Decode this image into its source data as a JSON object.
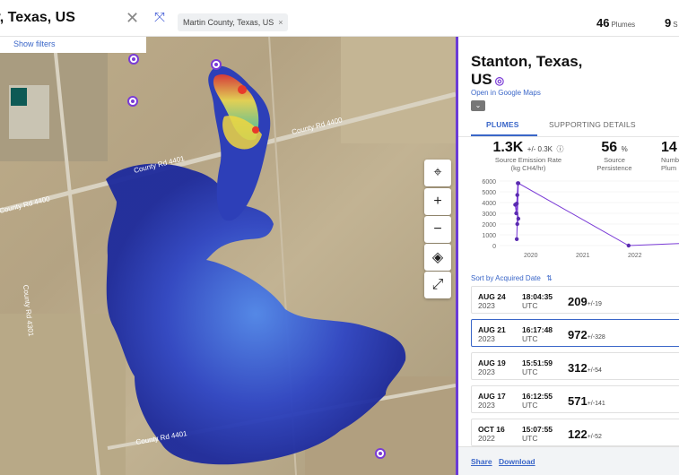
{
  "search": {
    "value": "y, Texas, US",
    "show_filters": "Show filters"
  },
  "filter_chip": {
    "label": "Martin County, Texas, US",
    "close": "×"
  },
  "counts": {
    "plumes_value": "46",
    "plumes_label": "Plumes",
    "sources_value": "9",
    "sources_label": "S"
  },
  "map": {
    "road_labels": [
      "County Rd 4400",
      "County Rd 4401",
      "County Rd 4400",
      "County Rd 4301",
      "County Rd 4401"
    ],
    "controls": [
      "locate-icon",
      "zoom-in-icon",
      "zoom-out-icon",
      "layers-icon",
      "measure-icon"
    ],
    "plume_colors": {
      "low": "#1f2fa6",
      "mid": "#3b6fe0",
      "high": "#f5e04a",
      "peak": "#e83a2a"
    }
  },
  "panel": {
    "title": "Stanton, Texas, US",
    "open_maps": "Open in Google Maps",
    "tabs": [
      "PLUMES",
      "SUPPORTING DETAILS"
    ],
    "stats": [
      {
        "value": "1.3K",
        "pm": "+/- 0.3K",
        "label1": "Source Emission Rate",
        "label2": "(kg CH4/hr)"
      },
      {
        "value": "56",
        "pm": "%",
        "label1": "Source",
        "label2": "Persistence"
      },
      {
        "value": "14",
        "pm": "",
        "label1": "Numbe",
        "label2": "Plum"
      }
    ],
    "sort": {
      "prefix": "Sort by",
      "field": "Acquired Date"
    },
    "rows": [
      {
        "date": "AUG 24",
        "year": "2023",
        "time": "18:04:35",
        "tz": "UTC",
        "value": "209",
        "pm": "+/-19",
        "selected": false
      },
      {
        "date": "AUG 21",
        "year": "2023",
        "time": "16:17:48",
        "tz": "UTC",
        "value": "972",
        "pm": "+/-328",
        "selected": true
      },
      {
        "date": "AUG 19",
        "year": "2023",
        "time": "15:51:59",
        "tz": "UTC",
        "value": "312",
        "pm": "+/-54",
        "selected": false
      },
      {
        "date": "AUG 17",
        "year": "2023",
        "time": "16:12:55",
        "tz": "UTC",
        "value": "571",
        "pm": "+/-141",
        "selected": false
      },
      {
        "date": "OCT 16",
        "year": "2022",
        "time": "15:07:55",
        "tz": "UTC",
        "value": "122",
        "pm": "+/-52",
        "selected": false
      }
    ],
    "footer": {
      "share": "Share",
      "download": "Download"
    }
  },
  "chart_data": {
    "type": "line",
    "yticks": [
      "6000",
      "5000",
      "4000",
      "3000",
      "2000",
      "1000",
      "0"
    ],
    "xticks": [
      "2020",
      "2021",
      "2022"
    ],
    "ylim": [
      0,
      6000
    ],
    "xlim": [
      2019.4,
      2022.9
    ],
    "series": [
      {
        "values": [
          [
            2019.7,
            3800
          ],
          [
            2019.72,
            3000
          ],
          [
            2019.75,
            5800
          ],
          [
            2019.74,
            4700
          ],
          [
            2019.73,
            3900
          ],
          [
            2019.76,
            2500
          ],
          [
            2019.74,
            2000
          ],
          [
            2019.73,
            600
          ],
          [
            2019.76,
            5800
          ],
          [
            2021.88,
            0
          ],
          [
            2022.9,
            200
          ]
        ]
      }
    ],
    "colors": {
      "line": "#7a3bd6",
      "point": "#5a2bb0"
    }
  }
}
